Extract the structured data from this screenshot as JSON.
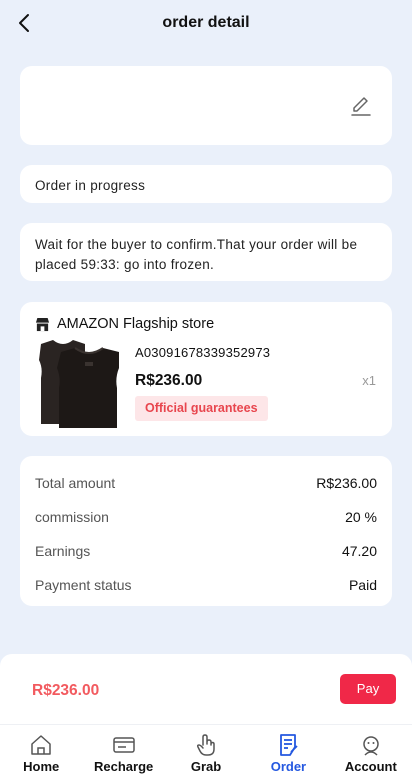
{
  "header": {
    "title": "order detail"
  },
  "status": {
    "text": "Order in progress"
  },
  "notice": {
    "text": "Wait for the buyer to confirm.That your order will be placed 59:33: go into frozen."
  },
  "product": {
    "store_name": "AMAZON Flagship store",
    "sku": "A03091678339352973",
    "price": "R$236.00",
    "quantity": "x1",
    "badge": "Official guarantees"
  },
  "summary": {
    "rows": [
      {
        "label": "Total amount",
        "value": "R$236.00"
      },
      {
        "label": "commission",
        "value": "20 %"
      },
      {
        "label": "Earnings",
        "value": "47.20"
      },
      {
        "label": "Payment status",
        "value": "Paid"
      }
    ]
  },
  "pay_bar": {
    "amount": "R$236.00",
    "button_label": "Pay"
  },
  "tabs": [
    {
      "label": "Home",
      "icon": "home-icon"
    },
    {
      "label": "Recharge",
      "icon": "recharge-icon"
    },
    {
      "label": "Grab",
      "icon": "grab-icon"
    },
    {
      "label": "Order",
      "icon": "order-icon"
    },
    {
      "label": "Account",
      "icon": "account-icon"
    }
  ],
  "active_tab": "Order",
  "colors": {
    "accent": "#2458e0",
    "pay_button": "#f02848",
    "price_red": "#f25a5f",
    "background": "#eaf0fa"
  }
}
